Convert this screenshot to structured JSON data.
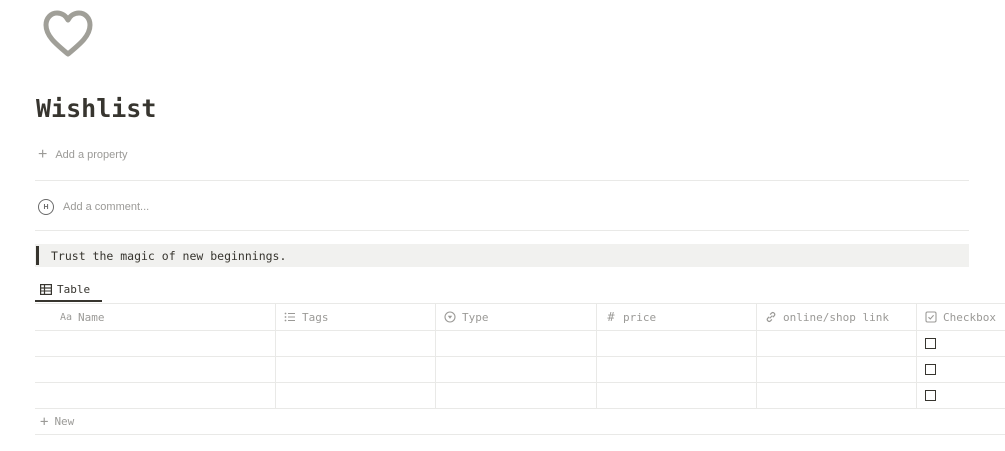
{
  "page": {
    "icon": "heart-outline-icon",
    "title": "Wishlist"
  },
  "properties": {
    "add_label": "Add a property"
  },
  "comments": {
    "avatar_initial": "H",
    "placeholder": "Add a comment..."
  },
  "callout": {
    "text": "Trust the magic of new beginnings."
  },
  "view": {
    "icon": "table-icon",
    "label": "Table"
  },
  "table": {
    "columns": [
      {
        "label": "Name",
        "icon": "aa-text-icon"
      },
      {
        "label": "Tags",
        "icon": "list-icon"
      },
      {
        "label": "Type",
        "icon": "select-circle-icon"
      },
      {
        "label": "price",
        "icon": "hash-icon"
      },
      {
        "label": "online/shop link",
        "icon": "link-icon"
      },
      {
        "label": "Checkbox",
        "icon": "checkbox-icon"
      }
    ],
    "rows": [
      {
        "name": "",
        "tags": "",
        "type": "",
        "price": "",
        "link": "",
        "checked": false
      },
      {
        "name": "",
        "tags": "",
        "type": "",
        "price": "",
        "link": "",
        "checked": false
      },
      {
        "name": "",
        "tags": "",
        "type": "",
        "price": "",
        "link": "",
        "checked": false
      }
    ],
    "new_label": "New"
  },
  "colors": {
    "text": "#37352f",
    "muted": "#9b9a97",
    "border": "#e9e9e7",
    "callout_bg": "#f1f1ef",
    "icon_gray": "#a09f98"
  }
}
